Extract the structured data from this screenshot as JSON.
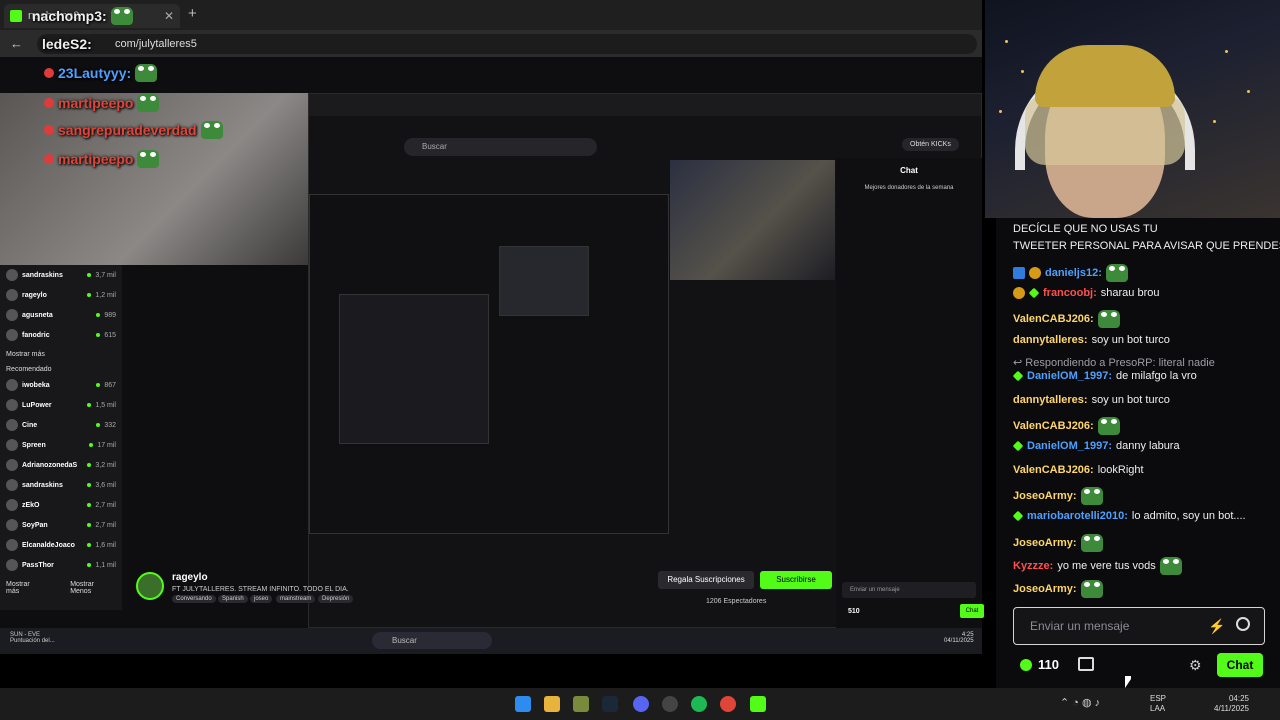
{
  "browser": {
    "tab_title": "nachomp3:",
    "url": "com/julytalleres5"
  },
  "overlay": [
    {
      "user": "nachomp3:",
      "color": "#ffffff"
    },
    {
      "user": "ledeS2:",
      "color": "#ffffff"
    },
    {
      "user": "23Lautyyy:",
      "color": "#4ea0ff"
    },
    {
      "user": "martipeepo",
      "color": "#e0453a"
    },
    {
      "user": "sangrepuradeverdad",
      "color": "#e0453a"
    },
    {
      "user": "martipeepo",
      "color": "#e0453a"
    }
  ],
  "inner": {
    "search": "Buscar",
    "kicks": "Obtén KICKs",
    "chat_title": "Chat",
    "donors_title": "Mejores donadores de la semana",
    "sidebar": [
      {
        "name": "sandraskins",
        "count": "3,7 mil"
      },
      {
        "name": "rageylo",
        "count": "1,2 mil"
      },
      {
        "name": "agusneta",
        "count": "989"
      },
      {
        "name": "fanodric",
        "count": "615"
      }
    ],
    "show_more": "Mostrar más",
    "recommended": "Recomendado",
    "recommended_list": [
      {
        "name": "iwobeka",
        "count": "867"
      },
      {
        "name": "LuPower",
        "count": "1,5 mil"
      },
      {
        "name": "Cine",
        "count": "332"
      },
      {
        "name": "Spreen",
        "count": "17 mil"
      },
      {
        "name": "AdrianozonedaS",
        "count": "3,2 mil"
      },
      {
        "name": "sandraskins",
        "count": "3,6 mil"
      },
      {
        "name": "zEkO",
        "count": "2,7 mil"
      },
      {
        "name": "SoyPan",
        "count": "2,7 mil"
      },
      {
        "name": "ElcanaldeJoaco",
        "count": "1,6 mil"
      },
      {
        "name": "PassThor",
        "count": "1,1 mil"
      }
    ],
    "show_more2": "Mostrar más",
    "show_less": "Mostrar Menos",
    "channel_name": "rageylo",
    "channel_title": "FT JULYTALLERES. STREAM INFINITO. TODO EL DIA.",
    "tags": [
      "Conversando",
      "Spanish",
      "joseo",
      "mainstream",
      "Depresión"
    ],
    "gift_btn": "Regala Suscripciones",
    "sub_btn": "Suscribirse",
    "viewers": "1206 Espectadores",
    "send_placeholder": "Enviar un mensaje",
    "points": "510",
    "chat_btn": "Chat",
    "task_search": "Buscar",
    "song": "SUN - EVE",
    "song_sub": "Puntuación del...",
    "time": "4:25",
    "date": "04/11/2025"
  },
  "chat": {
    "messages": [
      {
        "user": "",
        "text": "DECÍCLE QUE NO USAS TU",
        "color": "#ffffff"
      },
      {
        "user": "",
        "text": "TWEETER PERSONAL PARA AVISAR QUE PRENDES",
        "color": "#ffffff"
      },
      {
        "user": "danieljs12:",
        "text": "",
        "color": "#4ea0ff"
      },
      {
        "user": "francoobj:",
        "text": "sharau brou",
        "color": "#ff4f4f"
      },
      {
        "user": "ValenCABJ206:",
        "text": "",
        "color": "#ffd66b"
      },
      {
        "user": "dannytalleres:",
        "text": "soy un bot turco",
        "color": "#ffd66b"
      },
      {
        "user": "DanielOM_1997:",
        "text": "de milafgo la vro",
        "color": "#4ea0ff"
      },
      {
        "user": "dannytalleres:",
        "text": "soy un bot turco",
        "color": "#ffd66b"
      },
      {
        "user": "ValenCABJ206:",
        "text": "",
        "color": "#ffd66b"
      },
      {
        "user": "DanielOM_1997:",
        "text": "danny labura",
        "color": "#4ea0ff"
      },
      {
        "user": "ValenCABJ206:",
        "text": "lookRight",
        "color": "#ffd66b"
      },
      {
        "user": "JoseoArmy:",
        "text": "",
        "color": "#ffd66b"
      },
      {
        "user": "mariobarotelli2010:",
        "text": "lo admito, soy un bot....",
        "color": "#4ea0ff"
      },
      {
        "user": "JoseoArmy:",
        "text": "",
        "color": "#ffd66b"
      },
      {
        "user": "Kyzzze:",
        "text": "yo me vere tus vods",
        "color": "#ff4f4f"
      },
      {
        "user": "JoseoArmy:",
        "text": "",
        "color": "#ffd66b"
      }
    ],
    "reply_note": "Respondiendo a PresoRP: literal nadie",
    "input_placeholder": "Enviar un mensaje",
    "points": "110",
    "chat_button": "Chat"
  },
  "system": {
    "lang1": "ESP",
    "lang2": "LAA",
    "time": "04:25",
    "date": "4/11/2025"
  },
  "colors": {
    "kick_green": "#53fc18",
    "bg": "#0b0b0d"
  }
}
